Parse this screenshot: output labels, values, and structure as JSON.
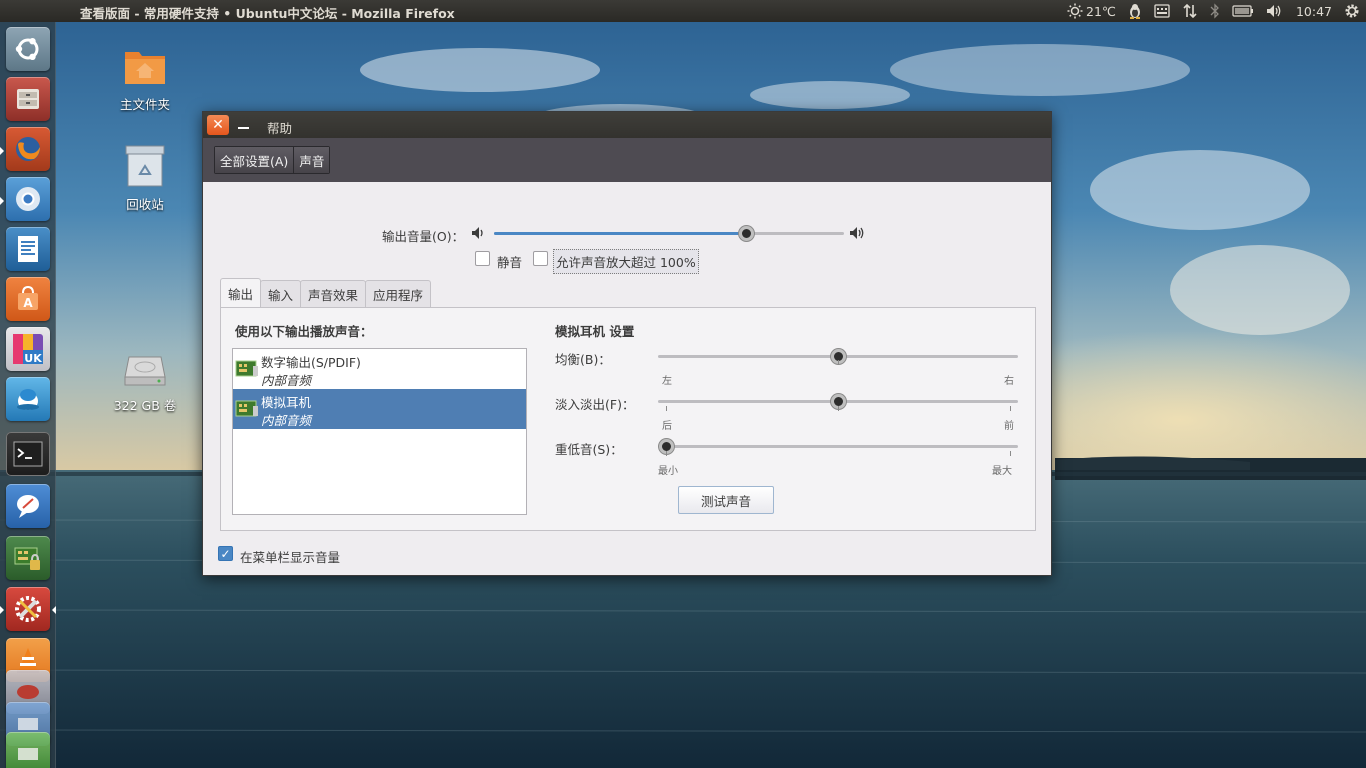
{
  "window_title": "查看版面 - 常用硬件支持 • Ubuntu中文论坛 - Mozilla Firefox",
  "indicators": {
    "weather_temp": "21℃",
    "clock": "10:47",
    "icons": [
      "weather-sun-icon",
      "tux-icon",
      "keyboard-icon",
      "network-arrows-icon",
      "bluetooth-icon",
      "battery-icon",
      "volume-icon",
      "gear-icon"
    ]
  },
  "desktop": {
    "icons": [
      {
        "label": "主文件夹",
        "icon": "home-folder-icon"
      },
      {
        "label": "回收站",
        "icon": "trash-icon"
      },
      {
        "label": "322 GB 卷",
        "icon": "drive-icon"
      }
    ]
  },
  "dialog": {
    "menu_help": "帮助",
    "breadcrumbs": [
      "全部设置(A)",
      "声音"
    ],
    "output_volume_label": "输出音量(O)：",
    "output_volume_level": 0.72,
    "mute_label": "静音",
    "mute_checked": false,
    "overamp_label": "允许声音放大超过 100%",
    "overamp_checked": false,
    "tabs": [
      "输出",
      "输入",
      "声音效果",
      "应用程序"
    ],
    "active_tab": "输出",
    "play_sound_through": "使用以下输出播放声音：",
    "devices": [
      {
        "name": "数字输出(S/PDIF)",
        "sub": "内部音频",
        "selected": false
      },
      {
        "name": "模拟耳机",
        "sub": "内部音频",
        "selected": true
      }
    ],
    "settings_title": "模拟耳机 设置",
    "balance": {
      "label": "均衡(B)：",
      "left": "左",
      "right": "右",
      "value": 0.5
    },
    "fade": {
      "label": "淡入淡出(F)：",
      "left": "后",
      "right": "前",
      "value": 0.5
    },
    "bass": {
      "label": "重低音(S)：",
      "left": "最小",
      "right": "最大",
      "value": 0.0
    },
    "test_sound": "测试声音",
    "show_in_menubar": "在菜单栏显示音量",
    "show_in_menubar_checked": true
  }
}
